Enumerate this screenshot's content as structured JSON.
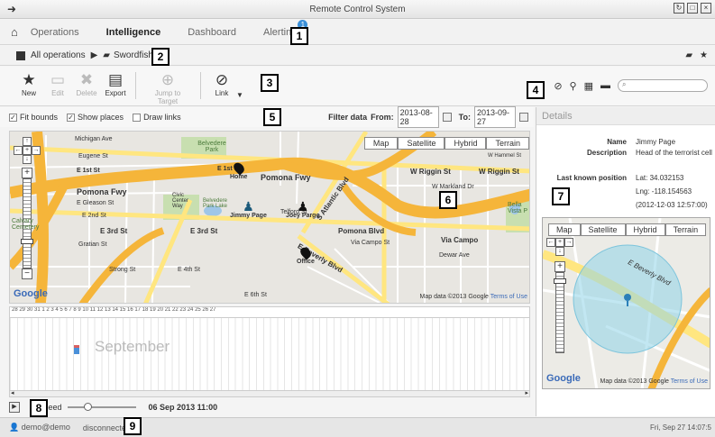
{
  "window": {
    "title": "Remote Control System"
  },
  "menu": {
    "home_icon": "home-icon",
    "items": [
      {
        "label": "Operations"
      },
      {
        "label": "Intelligence"
      },
      {
        "label": "Dashboard"
      },
      {
        "label": "Alerting",
        "badge": "1"
      }
    ]
  },
  "breadcrumb": {
    "root": "All operations",
    "arrow": "▶",
    "current": "Swordfish"
  },
  "toolbar": {
    "new": "New",
    "edit": "Edit",
    "delete": "Delete",
    "export": "Export",
    "jump": "Jump to Target",
    "link": "Link"
  },
  "filters": {
    "fit_bounds": "Fit bounds",
    "show_places": "Show places",
    "draw_links": "Draw links",
    "filter_label": "Filter data",
    "from_label": "From:",
    "from_value": "2013-08-28",
    "to_label": "To:",
    "to_value": "2013-09-27"
  },
  "map": {
    "buttons": [
      "Map",
      "Satellite",
      "Hybrid",
      "Terrain"
    ],
    "labels": {
      "michigan": "Michigan Ave",
      "eugene": "Eugene St",
      "first": "E 1st St",
      "first2": "E 1st St",
      "belvedere": "Belvedere Park",
      "pomona": "Pomona Fwy",
      "pomona2": "Pomona Fwy",
      "gleason": "E Gleason St",
      "second": "E 2nd St",
      "third": "E 3rd St",
      "third2": "E 3rd St",
      "gratian": "Gratian St",
      "strong": "Strong St",
      "fourth": "E 4th St",
      "sixth": "E 6th St",
      "home": "Home",
      "jimmy": "Jimmy Page",
      "joey": "Joey Pargo",
      "office": "Office",
      "telford": "Telford St",
      "pomona_blvd": "Pomona Blvd",
      "via_campo": "Via Campo St",
      "via_campo2": "Via Campo",
      "riggin": "W Riggin St",
      "riggin2": "W Riggin St",
      "markland": "W Markland Dr",
      "beverly": "E Beverly Blvd",
      "dewar": "Dewar Ave",
      "atlantic": "S Atlantic Blvd",
      "bella": "Bella Vista P",
      "park": "Belvedere Park Lake",
      "civic": "Civic Center Way",
      "cemetery": "Calvary Cemetery",
      "hammel": "W Hammel St"
    },
    "copyright": "Map data ©2013",
    "google": "Google",
    "terms": "Terms of Use"
  },
  "timeline": {
    "days": "28 29 30 31 1 2 3 4 5 6 7 8 9 10 11 12 13 14 15 16 17 18 19 20 21 22 23 24 25 26 27",
    "month": "September"
  },
  "player": {
    "speed_label": "speed",
    "time": "06 Sep 2013 11:00",
    "speed_level": 0.3
  },
  "details": {
    "header": "Details",
    "name_label": "Name",
    "name_value": "Jimmy Page",
    "desc_label": "Description",
    "desc_value": "Head of the terrorist cell",
    "pos_label": "Last known position",
    "lat": "Lat: 34.032153",
    "lng": "Lng: -118.154563",
    "ts": "(2012-12-03 12:57:00)",
    "mini_buttons": [
      "Map",
      "Satellite",
      "Hybrid",
      "Terrain"
    ],
    "mini_street": "E Beverly Blvd",
    "mini_copyright": "Map data ©2013",
    "mini_google": "Google",
    "mini_terms": "Terms of Use"
  },
  "status": {
    "user": "demo@demo",
    "connection": "disconnected",
    "clock": "Fri, Sep 27  14:07:5"
  },
  "callouts": [
    "1",
    "2",
    "3",
    "4",
    "5",
    "6",
    "7",
    "8",
    "9"
  ],
  "colors": {
    "highway": "#f5b53a",
    "road": "#ffe680",
    "accent": "#3a8fd8",
    "circle": "#8fd3e8"
  }
}
